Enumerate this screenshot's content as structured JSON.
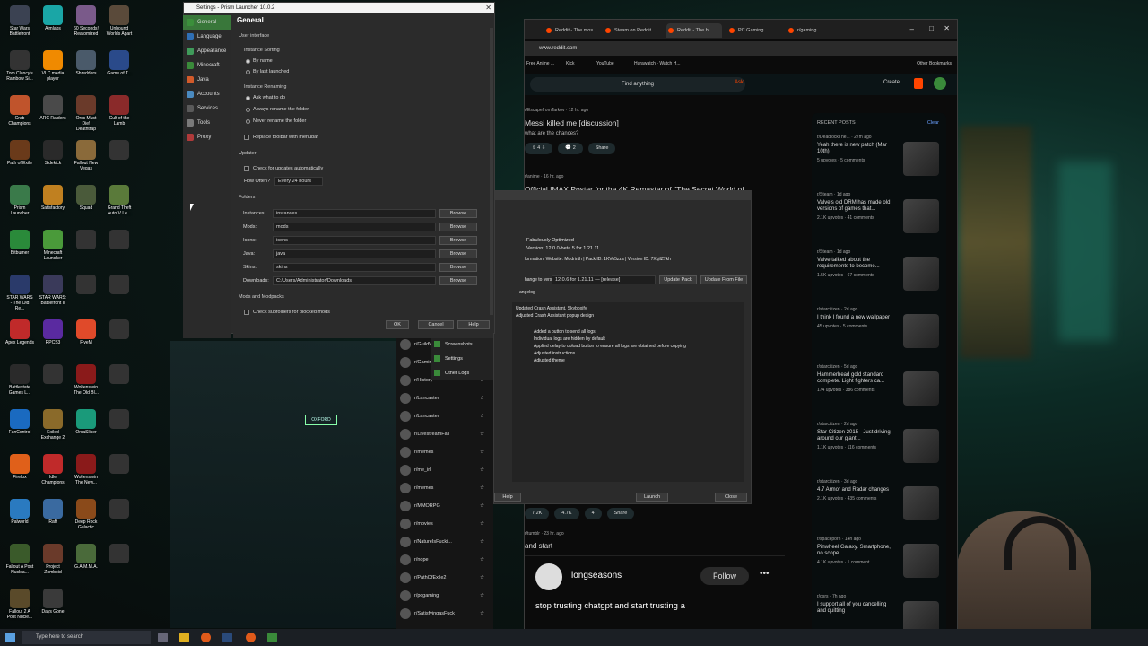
{
  "desktop": {
    "icons": [
      {
        "label": "Star Wars Battlefront",
        "color": "#3b4252"
      },
      {
        "label": "Aimlabs",
        "color": "#1aa6a6"
      },
      {
        "label": "60 Seconds! Reatomized",
        "color": "#7a5a8a"
      },
      {
        "label": "Unbound Worlds Apart",
        "color": "#5a4a3a"
      },
      {
        "label": "Tom Clancy's Rainbow Si...",
        "color": "#333"
      },
      {
        "label": "VLC media player",
        "color": "#f08a00"
      },
      {
        "label": "Shredders",
        "color": "#4a5a6a"
      },
      {
        "label": "Game of T...",
        "color": "#2a4a8a"
      },
      {
        "label": "Crab Champions",
        "color": "#c0542c"
      },
      {
        "label": "ARC Raiders",
        "color": "#4a4a4a"
      },
      {
        "label": "Orcs Must Die! Deathtrap",
        "color": "#6a3a2a"
      },
      {
        "label": "Cult of the Lamb",
        "color": "#8a2a2a"
      },
      {
        "label": "Path of Exile",
        "color": "#6a3a1a"
      },
      {
        "label": "Sidekick",
        "color": "#2a2a2a"
      },
      {
        "label": "Fallout New Vegas",
        "color": "#8a6a3a"
      },
      {
        "label": "",
        "color": "#333"
      },
      {
        "label": "Prism Launcher",
        "color": "#3a7a4a"
      },
      {
        "label": "Satisfactory",
        "color": "#c08020"
      },
      {
        "label": "Squad",
        "color": "#4a5a3a"
      },
      {
        "label": "Grand Theft Auto V Le...",
        "color": "#5a7a3a"
      },
      {
        "label": "Bitburner",
        "color": "#2a8a3a"
      },
      {
        "label": "Minecraft Launcher",
        "color": "#4a9a3a"
      },
      {
        "label": "",
        "color": "#333"
      },
      {
        "label": "",
        "color": "#333"
      },
      {
        "label": "STAR WARS - The Old Re...",
        "color": "#2a3a6a"
      },
      {
        "label": "STAR WARS: Battlefront II",
        "color": "#3a3a5a"
      },
      {
        "label": "",
        "color": "#333"
      },
      {
        "label": "",
        "color": "#333"
      },
      {
        "label": "Apex Legends",
        "color": "#c02a2a"
      },
      {
        "label": "RPCS3",
        "color": "#5a2aa0"
      },
      {
        "label": "FiveM",
        "color": "#e04a2a"
      },
      {
        "label": "",
        "color": "#333"
      },
      {
        "label": "Battlestate Games L...",
        "color": "#2a2a2a"
      },
      {
        "label": "",
        "color": "#333"
      },
      {
        "label": "Wolfenstein The Old Bl...",
        "color": "#8a1a1a"
      },
      {
        "label": "",
        "color": "#333"
      },
      {
        "label": "FanControl",
        "color": "#1a6ac0"
      },
      {
        "label": "Exiled Exchange 2",
        "color": "#8a6a2a"
      },
      {
        "label": "OrcaSlicer",
        "color": "#1a9a7a"
      },
      {
        "label": "",
        "color": "#333"
      },
      {
        "label": "Firefox",
        "color": "#e0601a"
      },
      {
        "label": "Idle Champions",
        "color": "#c02a2a"
      },
      {
        "label": "Wolfenstein The New...",
        "color": "#8a1a1a"
      },
      {
        "label": "",
        "color": "#333"
      },
      {
        "label": "Palworld",
        "color": "#2a7ac0"
      },
      {
        "label": "Raft",
        "color": "#3a6aa0"
      },
      {
        "label": "Deep Rock Galactic",
        "color": "#8a4a1a"
      },
      {
        "label": "",
        "color": "#333"
      },
      {
        "label": "Fallout A Post Nuclea...",
        "color": "#3a5a2a"
      },
      {
        "label": "Project Zomboid",
        "color": "#6a3a2a"
      },
      {
        "label": "G.A.M.M.A.",
        "color": "#4a6a3a"
      },
      {
        "label": "",
        "color": "#333"
      },
      {
        "label": "Fallout 2 A Post Nucle...",
        "color": "#5a4a2a"
      },
      {
        "label": "Days Gone",
        "color": "#3a3a3a"
      }
    ]
  },
  "settings": {
    "title": "Settings - Prism Launcher 10.0.2",
    "sidebar": [
      {
        "label": "General",
        "color": "#3b8f3b"
      },
      {
        "label": "Language",
        "color": "#2f6fb5"
      },
      {
        "label": "Appearance",
        "color": "#3f9a5a"
      },
      {
        "label": "Minecraft",
        "color": "#3a8a3a"
      },
      {
        "label": "Java",
        "color": "#d35a2a"
      },
      {
        "label": "Accounts",
        "color": "#4a8ac0"
      },
      {
        "label": "Services",
        "color": "#5a5a5a"
      },
      {
        "label": "Tools",
        "color": "#7a7a7a"
      },
      {
        "label": "Proxy",
        "color": "#b03a3a"
      }
    ],
    "page_title": "General",
    "user_interface": "User interface",
    "instance_sorting": "Instance Sorting",
    "by_name": "By name",
    "by_last_launched": "By last launched",
    "instance_renaming": "Instance Renaming",
    "ask_what_to_do": "Ask what to do",
    "always_rename": "Always rename the folder",
    "never_rename": "Never rename the folder",
    "replace_toolbar": "Replace toolbar with menubar",
    "updater": "Updater",
    "check_updates": "Check for updates automatically",
    "how_often_label": "How Often?",
    "how_often_value": "Every 24 hours",
    "folders": "Folders",
    "folder_rows": [
      {
        "label": "Instances:",
        "value": "instances"
      },
      {
        "label": "Mods:",
        "value": "mods"
      },
      {
        "label": "Icons:",
        "value": "icons"
      },
      {
        "label": "Java:",
        "value": "java"
      },
      {
        "label": "Skins:",
        "value": "skins"
      },
      {
        "label": "Downloads:",
        "value": "C:/Users/Administrator/Downloads"
      }
    ],
    "browse": "Browse",
    "mods_and_modpacks": "Mods and Modpacks",
    "check_subfolders": "Check subfolders for blocked mods",
    "ok": "OK",
    "cancel": "Cancel",
    "help": "Help"
  },
  "browser": {
    "tabs": [
      "Reddit - The mos",
      "Steam on Reddit",
      "Reddit - The h",
      "PC Gaming",
      "r/gaming"
    ],
    "url": "www.reddit.com",
    "bookmarks": [
      "Free Anime ...",
      "Kick",
      "YouTube",
      "Hurawatch - Watch H...",
      "Other Bookmarks"
    ],
    "search_placeholder": "Find anything",
    "ask": "Ask",
    "create": "Create",
    "posts": [
      {
        "sub": "r/EscapefromTarkov · 12 hr. ago",
        "title": "Messi killed me [discussion]",
        "body": "what are the chances?",
        "votes": "4",
        "comments": "2",
        "share": "Share"
      },
      {
        "sub": "r/anime · 16 hr. ago",
        "title": "Official IMAX Poster for the 4K Remaster of \"The Secret World of"
      }
    ],
    "bottom_post": {
      "votes": "7.2K",
      "comments": "4.7K",
      "awards": "4",
      "share": "Share",
      "sub": "r/tumblr · 23 hr. ago",
      "title": "and start",
      "user": "longseasons",
      "follow": "Follow",
      "text": "stop trusting chatgpt and start trusting a"
    },
    "recent_title": "RECENT POSTS",
    "clear": "Clear",
    "recent": [
      {
        "sub": "r/DeadlockThe... · 27m ago",
        "title": "Yeah there is new patch (Mar 10th)",
        "meta": "5 upvotes · 5 comments"
      },
      {
        "sub": "r/Steam · 1d ago",
        "title": "Valve's old DRM has made old versions of games that...",
        "meta": "2.1K upvotes · 41 comments"
      },
      {
        "sub": "r/Steam · 1d ago",
        "title": "Valve talked about the requirements to become...",
        "meta": "1.5K upvotes · 67 comments"
      },
      {
        "sub": "r/starcitizen · 2d ago",
        "title": "I think I found a new wallpaper",
        "meta": "45 upvotes · 5 comments"
      },
      {
        "sub": "r/starcitizen · 5d ago",
        "title": "Hammerhead gold standard complete. Light fighters ca...",
        "meta": "174 upvotes · 386 comments"
      },
      {
        "sub": "r/starcitizen · 2d ago",
        "title": "Star Citizen 2015 - Just driving around our giant...",
        "meta": "1.1K upvotes · 116 comments"
      },
      {
        "sub": "r/starcitizen · 3d ago",
        "title": "4.7 Armor and Radar changes",
        "meta": "2.1K upvotes · 435 comments"
      },
      {
        "sub": "r/spaceporn · 14h ago",
        "title": "Pinwheel Galaxy. Smartphone, no scope",
        "meta": "4.1K upvotes · 1 comment"
      },
      {
        "sub": "r/osrs · 7h ago",
        "title": "I support all of you cancelling and quitting",
        "meta": ""
      }
    ]
  },
  "prism_main": {
    "version_line": "Fabulously Optimized",
    "version_detail": "Version: 12.0.0-beta.5 for 1.21.11",
    "info": "formation: Website: Modrinth | Pack ID: 1KVo5zza | Version ID: 7XqilZ7kh",
    "change_label": "hange to version:",
    "change_value": "12.0.6 for 1.21.11 — [release]",
    "update_pack": "Update Pack",
    "update_from_file": "Update From File",
    "changelog": "angelog",
    "changes": [
      "Updated Crash Assistant, Skyboxify",
      "Adjusted Crash Assistant popup design",
      "Added a button to send all logs",
      "Individual logs are hidden by default",
      "Applied delay to upload button to ensure all logs are obtained before copying",
      "Adjusted instructions",
      "Adjusted theme"
    ],
    "help": "Help",
    "launch": "Launch",
    "close": "Close",
    "side_items": [
      "Screenshots",
      "Settings",
      "Other Logs"
    ]
  },
  "subreddits": [
    "r/GuildWars",
    "r/Gaming",
    "r/History",
    "r/Lancaster",
    "r/Lancaster",
    "r/LivestreamFail",
    "r/memes",
    "r/me_irl",
    "r/memes",
    "r/MMORPG",
    "r/movies",
    "r/NatureIsFucki...",
    "r/nope",
    "r/PathOfExile2",
    "r/pcgaming",
    "r/SatisfyingasFuck"
  ],
  "taskbar": {
    "search": "Type here to search"
  }
}
